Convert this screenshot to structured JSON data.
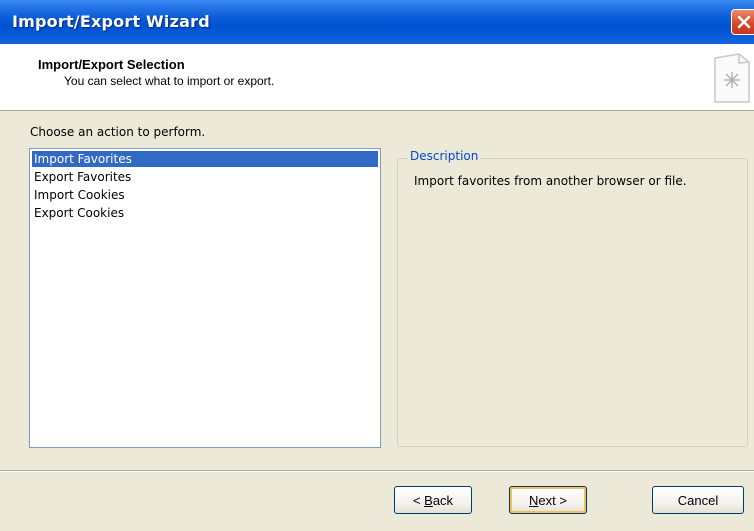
{
  "window": {
    "title": "Import/Export Wizard"
  },
  "header": {
    "title": "Import/Export Selection",
    "subtitle": "You can select what to import or export."
  },
  "actions": {
    "label": "Choose an action to perform.",
    "items": [
      {
        "label": "Import Favorites",
        "selected": true
      },
      {
        "label": "Export Favorites",
        "selected": false
      },
      {
        "label": "Import Cookies",
        "selected": false
      },
      {
        "label": "Export Cookies",
        "selected": false
      }
    ]
  },
  "description": {
    "label": "Description",
    "text": "Import favorites from another browser or file."
  },
  "buttons": {
    "back": {
      "prefix": "< ",
      "mnemonic": "B",
      "rest": "ack"
    },
    "next": {
      "mnemonic": "N",
      "rest": "ext >"
    },
    "cancel": "Cancel"
  },
  "colors": {
    "titlebar": "#0a5cd8",
    "selection": "#316ac5",
    "group_label": "#0046d5",
    "close_button": "#d4452a"
  },
  "icons": {
    "close": "close-icon",
    "wizard": "document-icon"
  }
}
